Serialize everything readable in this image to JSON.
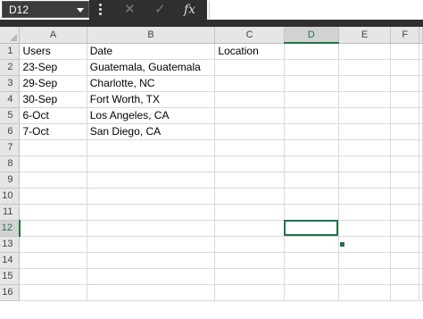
{
  "formula_bar": {
    "name_box": "D12",
    "cancel_icon": "✕",
    "enter_icon": "✓",
    "function_icon": "fx",
    "formula": ""
  },
  "columns": [
    "A",
    "B",
    "C",
    "D",
    "E",
    "F"
  ],
  "selected_cell": {
    "column": "D",
    "row": 12
  },
  "rows": [
    {
      "num": "1",
      "cells": [
        "Users",
        "Date",
        "Location",
        "",
        "",
        ""
      ]
    },
    {
      "num": "2",
      "cells": [
        "23-Sep",
        "Guatemala, Guatemala",
        "",
        "",
        "",
        ""
      ]
    },
    {
      "num": "3",
      "cells": [
        "29-Sep",
        "Charlotte, NC",
        "",
        "",
        "",
        ""
      ]
    },
    {
      "num": "4",
      "cells": [
        "30-Sep",
        "Fort Worth, TX",
        "",
        "",
        "",
        ""
      ]
    },
    {
      "num": "5",
      "cells": [
        "6-Oct",
        "Los Angeles, CA",
        "",
        "",
        "",
        ""
      ]
    },
    {
      "num": "6",
      "cells": [
        "7-Oct",
        "San Diego, CA",
        "",
        "",
        "",
        ""
      ]
    },
    {
      "num": "7",
      "cells": [
        "",
        "",
        "",
        "",
        "",
        ""
      ]
    },
    {
      "num": "8",
      "cells": [
        "",
        "",
        "",
        "",
        "",
        ""
      ]
    },
    {
      "num": "9",
      "cells": [
        "",
        "",
        "",
        "",
        "",
        ""
      ]
    },
    {
      "num": "10",
      "cells": [
        "",
        "",
        "",
        "",
        "",
        ""
      ]
    },
    {
      "num": "11",
      "cells": [
        "",
        "",
        "",
        "",
        "",
        ""
      ]
    },
    {
      "num": "12",
      "cells": [
        "",
        "",
        "",
        "",
        "",
        ""
      ]
    },
    {
      "num": "13",
      "cells": [
        "",
        "",
        "",
        "",
        "",
        ""
      ]
    },
    {
      "num": "14",
      "cells": [
        "",
        "",
        "",
        "",
        "",
        ""
      ]
    },
    {
      "num": "15",
      "cells": [
        "",
        "",
        "",
        "",
        "",
        ""
      ]
    },
    {
      "num": "16",
      "cells": [
        "",
        "",
        "",
        "",
        "",
        ""
      ]
    }
  ],
  "colors": {
    "accent": "#217346",
    "header_bg": "#e6e6e6",
    "toolbar_dark": "#2f2f2f"
  }
}
